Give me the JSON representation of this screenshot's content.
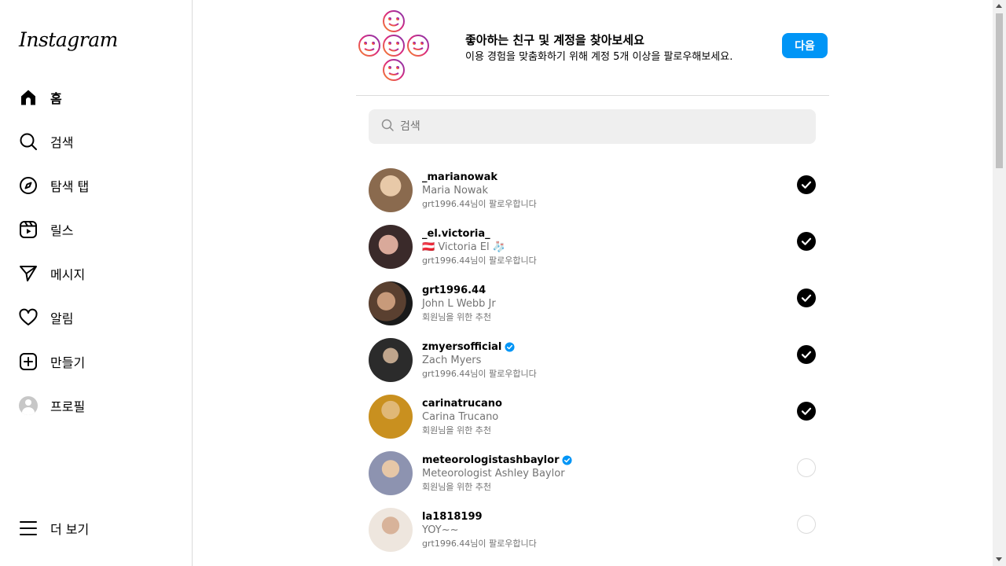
{
  "sidebar": {
    "logo": "Instagram",
    "items": [
      {
        "label": "홈",
        "icon": "home-icon"
      },
      {
        "label": "검색",
        "icon": "search-icon"
      },
      {
        "label": "탐색 탭",
        "icon": "compass-icon"
      },
      {
        "label": "릴스",
        "icon": "reels-icon"
      },
      {
        "label": "메시지",
        "icon": "send-icon"
      },
      {
        "label": "알림",
        "icon": "heart-icon"
      },
      {
        "label": "만들기",
        "icon": "plus-square-icon"
      },
      {
        "label": "프로필",
        "icon": "avatar"
      }
    ],
    "more_label": "더 보기"
  },
  "header": {
    "title": "좋아하는 친구 및 계정을 찾아보세요",
    "subtitle": "이용 경험을 맞춤화하기 위해 계정 5개 이상을 팔로우해보세요.",
    "next_label": "다음"
  },
  "search": {
    "placeholder": "검색"
  },
  "suggestions": [
    {
      "username": "_marianowak",
      "full_name": "Maria Nowak",
      "reason": "grt1996.44님이 팔로우합니다",
      "verified": false,
      "selected": true
    },
    {
      "username": "_el.victoria_",
      "full_name": "🇦🇹 Victoria El 🧦",
      "reason": "grt1996.44님이 팔로우합니다",
      "verified": false,
      "selected": true
    },
    {
      "username": "grt1996.44",
      "full_name": "John L Webb Jr",
      "reason": "회원님을 위한 추천",
      "verified": false,
      "selected": true
    },
    {
      "username": "zmyersofficial",
      "full_name": "Zach Myers",
      "reason": "grt1996.44님이 팔로우합니다",
      "verified": true,
      "selected": true
    },
    {
      "username": "carinatrucano",
      "full_name": "Carina Trucano",
      "reason": "회원님을 위한 추천",
      "verified": false,
      "selected": true
    },
    {
      "username": "meteorologistashbaylor",
      "full_name": "Meteorologist Ashley Baylor",
      "reason": "회원님을 위한 추천",
      "verified": true,
      "selected": false
    },
    {
      "username": "la1818199",
      "full_name": "YOY~~",
      "reason": "grt1996.44님이 팔로우합니다",
      "verified": false,
      "selected": false
    }
  ],
  "colors": {
    "accent": "#0095f6",
    "secondary_text": "#737373",
    "verified": "#0095f6"
  }
}
